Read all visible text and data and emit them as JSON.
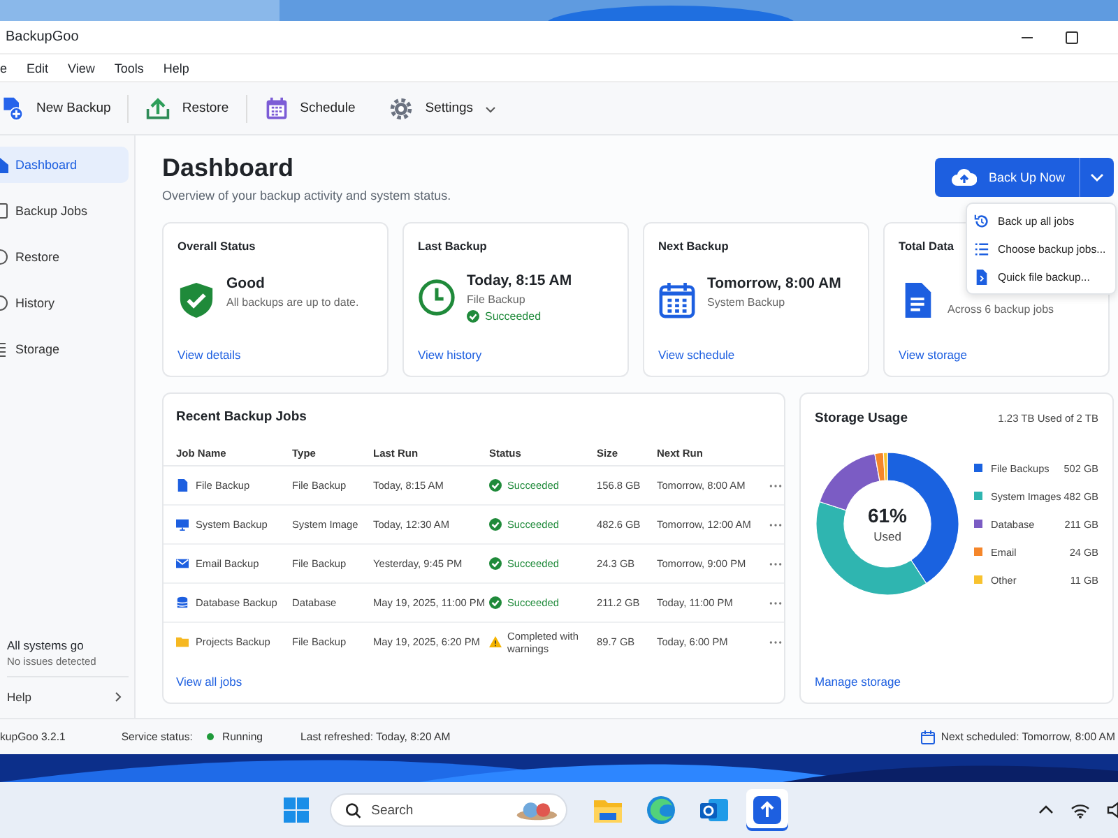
{
  "window": {
    "title": "BackupGoo"
  },
  "menu": [
    "e",
    "Edit",
    "View",
    "Tools",
    "Help"
  ],
  "toolbar": [
    {
      "kind": "new",
      "label": "New Backup",
      "caret": false
    },
    {
      "kind": "restore",
      "label": "Restore",
      "caret": false
    },
    {
      "kind": "schedule",
      "label": "Schedule",
      "caret": false
    },
    {
      "kind": "settings",
      "label": "Settings",
      "caret": true
    }
  ],
  "sidebar": {
    "items": [
      {
        "kind": "home",
        "label": "Dashboard",
        "selected": true
      },
      {
        "kind": "jobs",
        "label": "Backup Jobs",
        "selected": false
      },
      {
        "kind": "restore",
        "label": "Restore",
        "selected": false
      },
      {
        "kind": "history",
        "label": "History",
        "selected": false
      },
      {
        "kind": "storage",
        "label": "Storage",
        "selected": false
      }
    ],
    "status_title": "All systems go",
    "status_text": "No issues detected",
    "help": "Help"
  },
  "header": {
    "title": "Dashboard",
    "subtitle": "Overview of your backup activity and system status.",
    "primary_button": "Back Up Now",
    "menu": [
      {
        "kind": "all",
        "label": "Back up all jobs"
      },
      {
        "kind": "choose",
        "label": "Choose backup jobs..."
      },
      {
        "kind": "quick",
        "label": "Quick file backup..."
      }
    ]
  },
  "cards": [
    {
      "title": "Overall Status",
      "kind": "shield",
      "value": "Good",
      "subtitle": "All backups are up to date.",
      "link": "View details"
    },
    {
      "title": "Last Backup",
      "kind": "clock",
      "value": "Today, 8:15 AM",
      "subtitle": "File Backup",
      "status": "Succeeded",
      "link": "View history"
    },
    {
      "title": "Next Backup",
      "kind": "calendar",
      "value": "Tomorrow, 8:00 AM",
      "subtitle": "System Backup",
      "link": "View schedule"
    },
    {
      "title": "Total Data",
      "kind": "document",
      "subtitle": "Across 6 backup jobs",
      "link": "View storage"
    }
  ],
  "jobs": {
    "title": "Recent Backup Jobs",
    "columns": [
      "Job Name",
      "Type",
      "Last Run",
      "Status",
      "Size",
      "Next Run"
    ],
    "rows": [
      {
        "kind": "file",
        "name": "File Backup",
        "type": "File Backup",
        "last_run": "Today, 8:15 AM",
        "status": {
          "kind": "success",
          "text": "Succeeded"
        },
        "size": "156.8 GB",
        "next_run": "Tomorrow, 8:00 AM"
      },
      {
        "kind": "monitor",
        "name": "System Backup",
        "type": "System Image",
        "last_run": "Today, 12:30 AM",
        "status": {
          "kind": "success",
          "text": "Succeeded"
        },
        "size": "482.6 GB",
        "next_run": "Tomorrow, 12:00 AM"
      },
      {
        "kind": "mail",
        "name": "Email Backup",
        "type": "File Backup",
        "last_run": "Yesterday, 9:45 PM",
        "status": {
          "kind": "success",
          "text": "Succeeded"
        },
        "size": "24.3 GB",
        "next_run": "Tomorrow, 9:00 PM"
      },
      {
        "kind": "database",
        "name": "Database Backup",
        "type": "Database",
        "last_run": "May 19, 2025, 11:00 PM",
        "status": {
          "kind": "success",
          "text": "Succeeded"
        },
        "size": "211.2 GB",
        "next_run": "Today, 11:00 PM"
      },
      {
        "kind": "folder",
        "name": "Projects Backup",
        "type": "File Backup",
        "last_run": "May 19, 2025, 6:20 PM",
        "status": {
          "kind": "warning",
          "text": "Completed with warnings"
        },
        "size": "89.7 GB",
        "next_run": "Today, 6:00 PM"
      }
    ],
    "link": "View all jobs"
  },
  "storage": {
    "title": "Storage Usage",
    "summary": "1.23 TB Used of 2 TB",
    "percent": "61%",
    "percent_label": "Used",
    "link": "Manage storage",
    "chart_data": {
      "type": "donut",
      "categories": [
        "File Backups",
        "System Images",
        "Database",
        "Email",
        "Other"
      ],
      "values": [
        502,
        482,
        211,
        24,
        11
      ],
      "legend": "right",
      "colors": [
        "#1a62e0",
        "#2fb5b0",
        "#7b5cc4",
        "#f5862a",
        "#f8c22e"
      ],
      "value_labels": [
        "502 GB",
        "482 GB",
        "211 GB",
        "24 GB",
        "11 GB"
      ]
    }
  },
  "status_bar": {
    "version": "kupGoo 3.2.1",
    "service_label": "Service status:",
    "service_state": "Running",
    "running": true,
    "refreshed": "Last refreshed: Today, 8:20 AM",
    "next": "Next scheduled: Tomorrow, 8:00 AM"
  },
  "taskbar": {
    "search_placeholder": "Search",
    "apps": [
      {
        "kind": "folder",
        "selected": false
      },
      {
        "kind": "browser",
        "selected": false
      },
      {
        "kind": "mail",
        "selected": false
      },
      {
        "kind": "backup",
        "selected": true
      }
    ]
  }
}
